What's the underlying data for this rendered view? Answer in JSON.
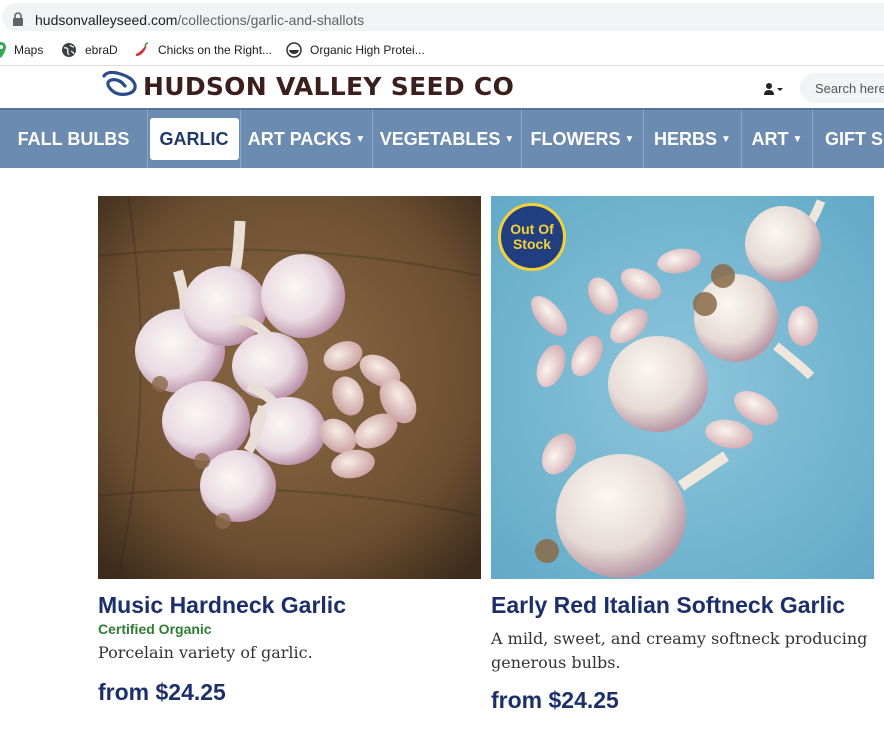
{
  "browser": {
    "url_host": "hudsonvalleyseed.com",
    "url_path": "/collections/garlic-and-shallots",
    "bookmarks": [
      {
        "label": "Maps",
        "icon": "maps-icon"
      },
      {
        "label": "ebraD",
        "icon": "globe-icon"
      },
      {
        "label": "Chicks on the Right...",
        "icon": "chili-icon"
      },
      {
        "label": "Organic High Protei...",
        "icon": "bowl-icon"
      }
    ]
  },
  "header": {
    "logo_text": "HUDSON VALLEY SEED CO",
    "search_placeholder": "Search here..."
  },
  "nav": {
    "items": [
      {
        "label": "FALL BULBS",
        "has_caret": false,
        "active": false
      },
      {
        "label": "GARLIC",
        "has_caret": false,
        "active": true
      },
      {
        "label": "ART PACKS",
        "has_caret": true,
        "active": false
      },
      {
        "label": "VEGETABLES",
        "has_caret": true,
        "active": false
      },
      {
        "label": "FLOWERS",
        "has_caret": true,
        "active": false
      },
      {
        "label": "HERBS",
        "has_caret": true,
        "active": false
      },
      {
        "label": "ART",
        "has_caret": true,
        "active": false
      },
      {
        "label": "GIFT SE",
        "has_caret": false,
        "active": false
      }
    ]
  },
  "products": [
    {
      "title": "Music Hardneck Garlic",
      "certification": "Certified Organic",
      "description": "Porcelain variety of garlic.",
      "price": "from $24.25",
      "badge": ""
    },
    {
      "title": "Early Red Italian Softneck Garlic",
      "certification": "",
      "description": "A mild, sweet, and creamy softneck producing generous bulbs.",
      "price": "from $24.25",
      "badge_line1": "Out Of",
      "badge_line2": "Stock"
    }
  ],
  "colors": {
    "nav_bg": "#6b8bb0",
    "title_blue": "#1d2f6b",
    "organic_green": "#2e7d32",
    "badge_bg": "#213f80",
    "badge_ring": "#f2d13a"
  }
}
